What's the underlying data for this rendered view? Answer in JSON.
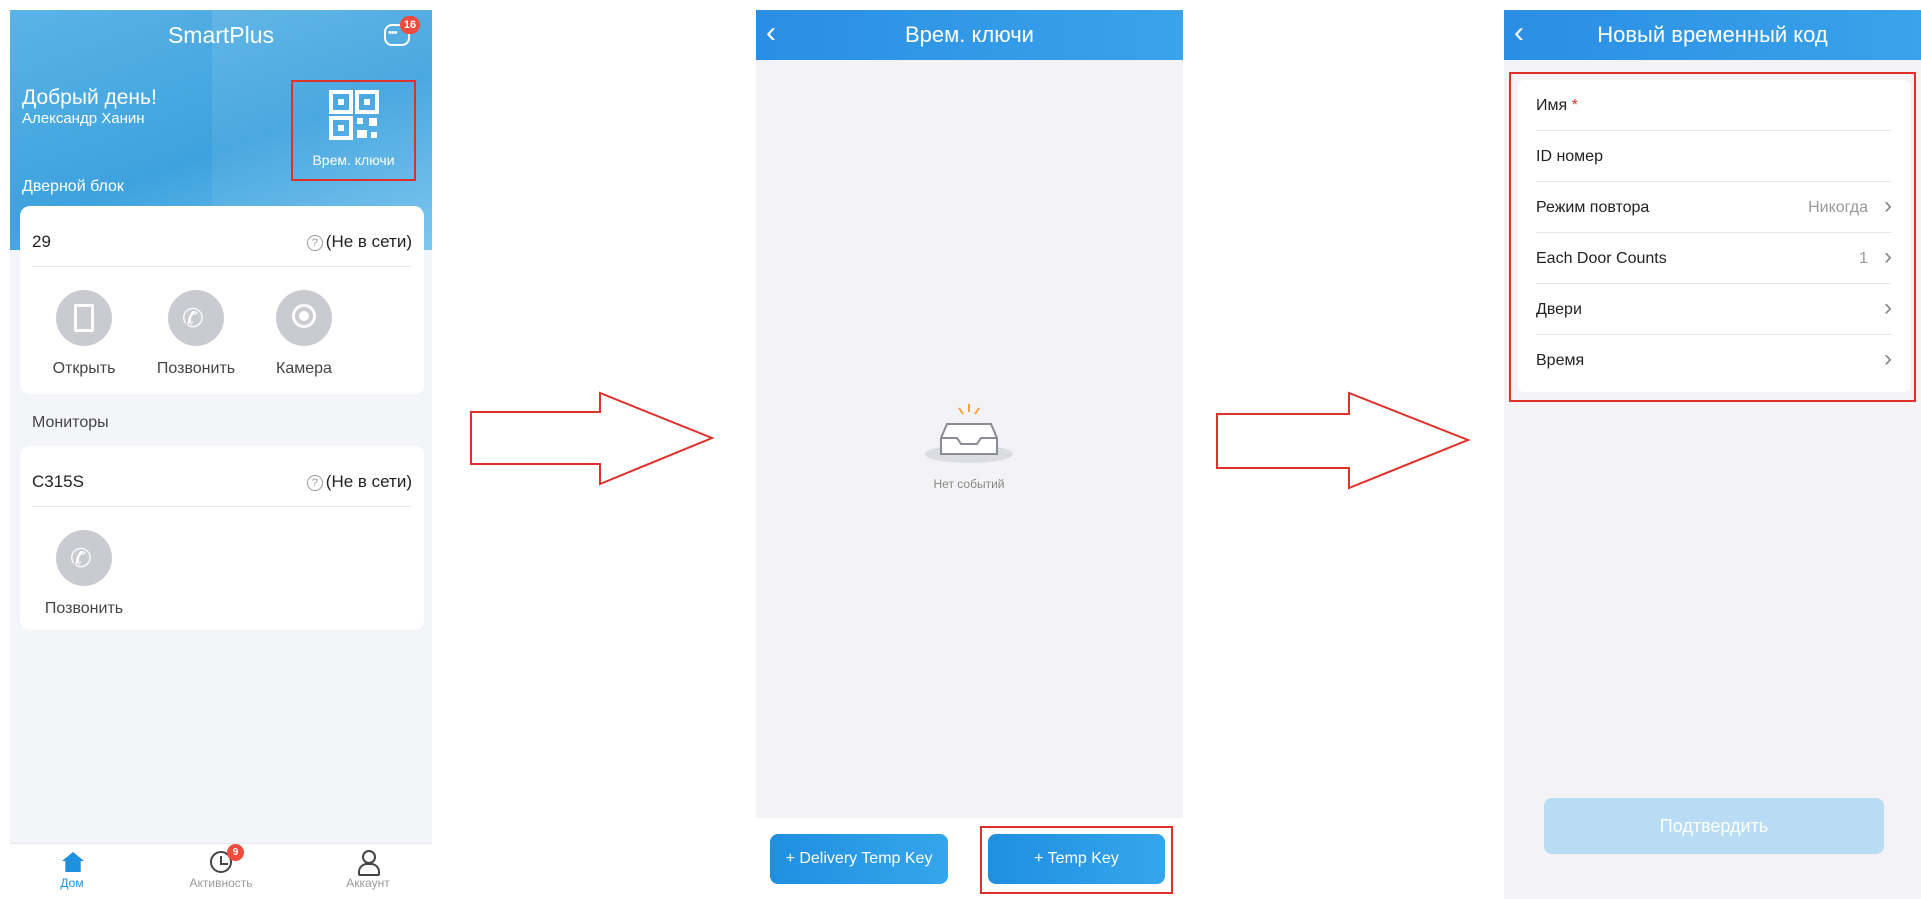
{
  "screen1": {
    "app_title": "SmartPlus",
    "message_badge": "16",
    "greeting": "Добрый день!",
    "user_name": "Александр Ханин",
    "temp_keys_label": "Врем. ключи",
    "door_section_label": "Дверной блок",
    "door_device": {
      "name": "29",
      "status": "(Не в сети)",
      "actions": [
        {
          "label": "Открыть",
          "icon": "door-icon"
        },
        {
          "label": "Позвонить",
          "icon": "phone-icon"
        },
        {
          "label": "Камера",
          "icon": "camera-icon"
        }
      ]
    },
    "monitors_section_label": "Мониторы",
    "monitor_device": {
      "name": "C315S",
      "status": "(Не в сети)",
      "actions": [
        {
          "label": "Позвонить",
          "icon": "phone-icon"
        }
      ]
    },
    "tabs": [
      {
        "label": "Дом",
        "icon": "home-icon",
        "active": true
      },
      {
        "label": "Активность",
        "icon": "clock-icon",
        "badge": "9"
      },
      {
        "label": "Аккаунт",
        "icon": "person-icon"
      }
    ]
  },
  "screen2": {
    "title": "Врем. ключи",
    "empty_text": "Нет событий",
    "delivery_button": "+ Delivery Temp Key",
    "temp_key_button": "+ Temp Key"
  },
  "screen3": {
    "title": "Новый временный код",
    "fields": [
      {
        "label": "Имя",
        "required_mark": "*"
      },
      {
        "label": "ID номер"
      },
      {
        "label": "Режим повтора",
        "value": "Никогда"
      },
      {
        "label": "Each Door Counts",
        "value": "1"
      },
      {
        "label": "Двери"
      },
      {
        "label": "Время"
      }
    ],
    "confirm_button": "Подтвердить"
  },
  "colors": {
    "accent": "#1f8fe0",
    "highlight_outline": "#e0302a",
    "badge": "#f04b3c",
    "disabled_button": "#b7dcf3"
  }
}
